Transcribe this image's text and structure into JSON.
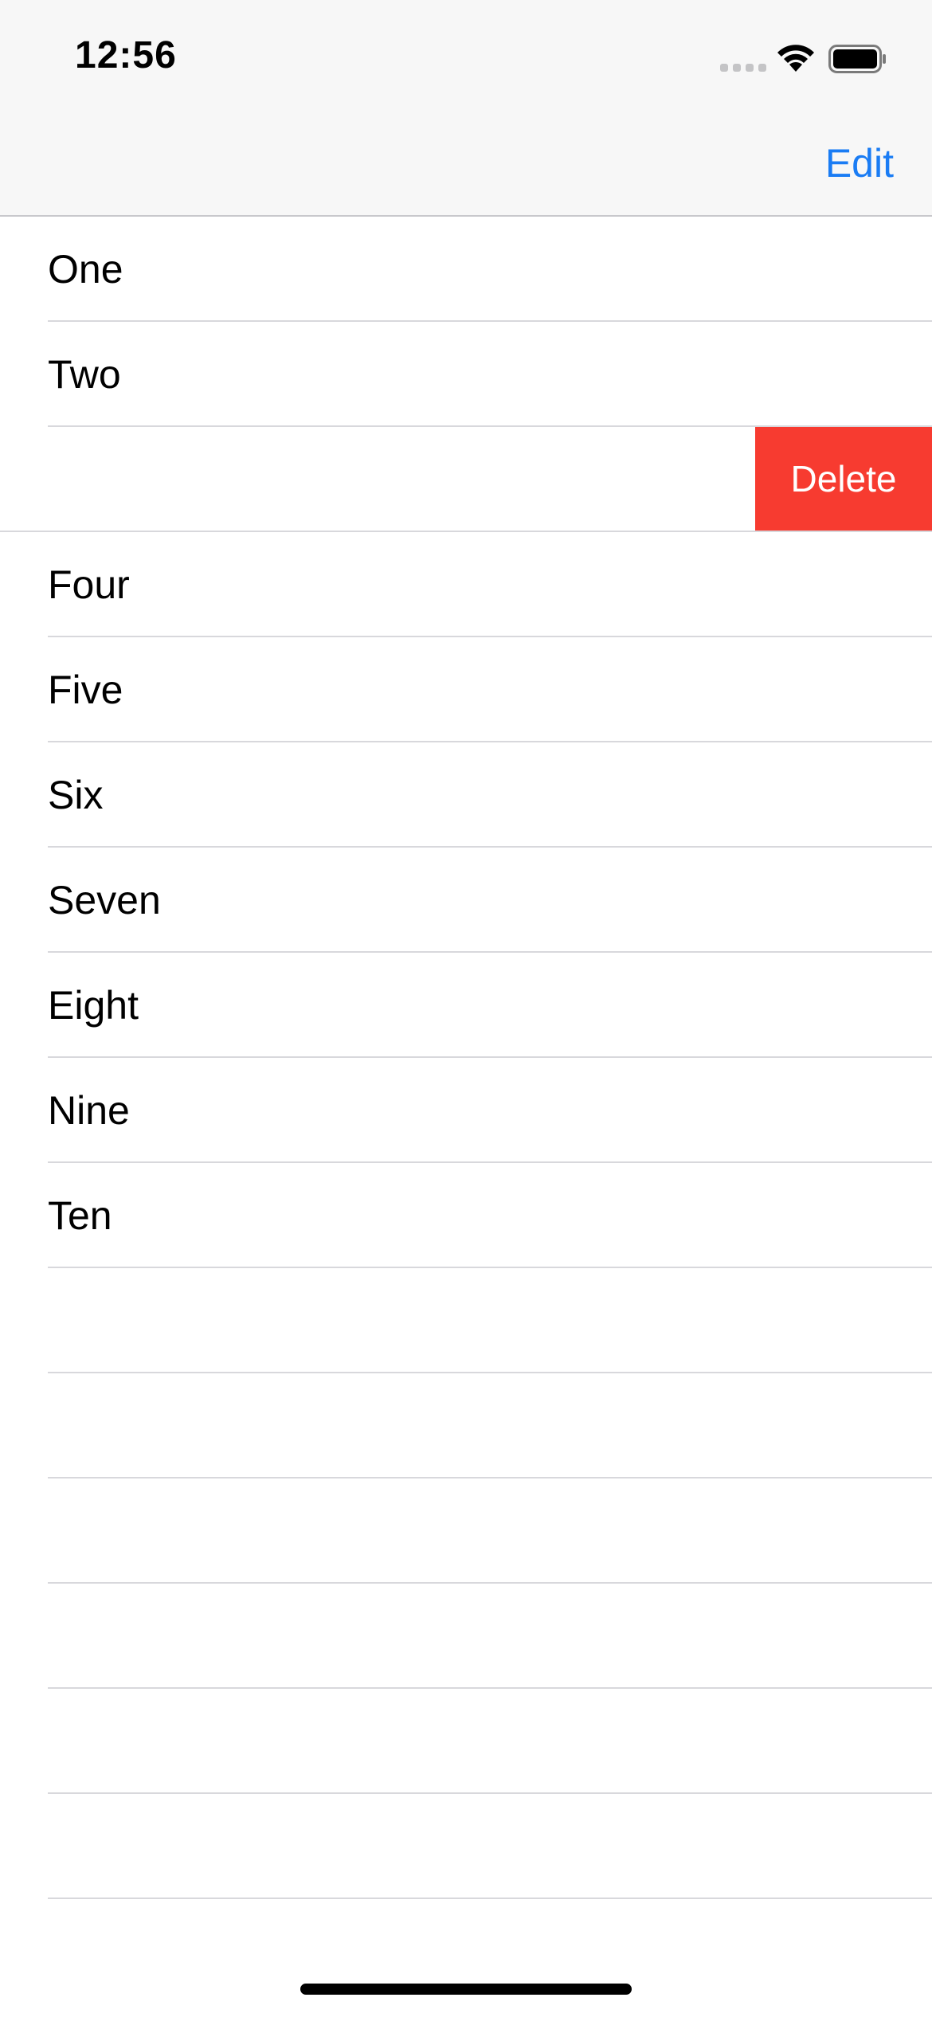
{
  "status_bar": {
    "time": "12:56",
    "icons": [
      "cellular-signal-icon",
      "wifi-icon",
      "battery-icon"
    ]
  },
  "nav_bar": {
    "edit_label": "Edit",
    "accent_color": "#1a7cf4"
  },
  "rows": [
    {
      "label": "One"
    },
    {
      "label": "Two"
    },
    {
      "label": "",
      "swiped": true,
      "action_label": "Delete",
      "action_color": "#f73b30"
    },
    {
      "label": "Four"
    },
    {
      "label": "Five"
    },
    {
      "label": "Six"
    },
    {
      "label": "Seven"
    },
    {
      "label": "Eight"
    },
    {
      "label": "Nine"
    },
    {
      "label": "Ten"
    },
    {
      "label": ""
    },
    {
      "label": ""
    },
    {
      "label": ""
    },
    {
      "label": ""
    },
    {
      "label": ""
    },
    {
      "label": ""
    }
  ]
}
